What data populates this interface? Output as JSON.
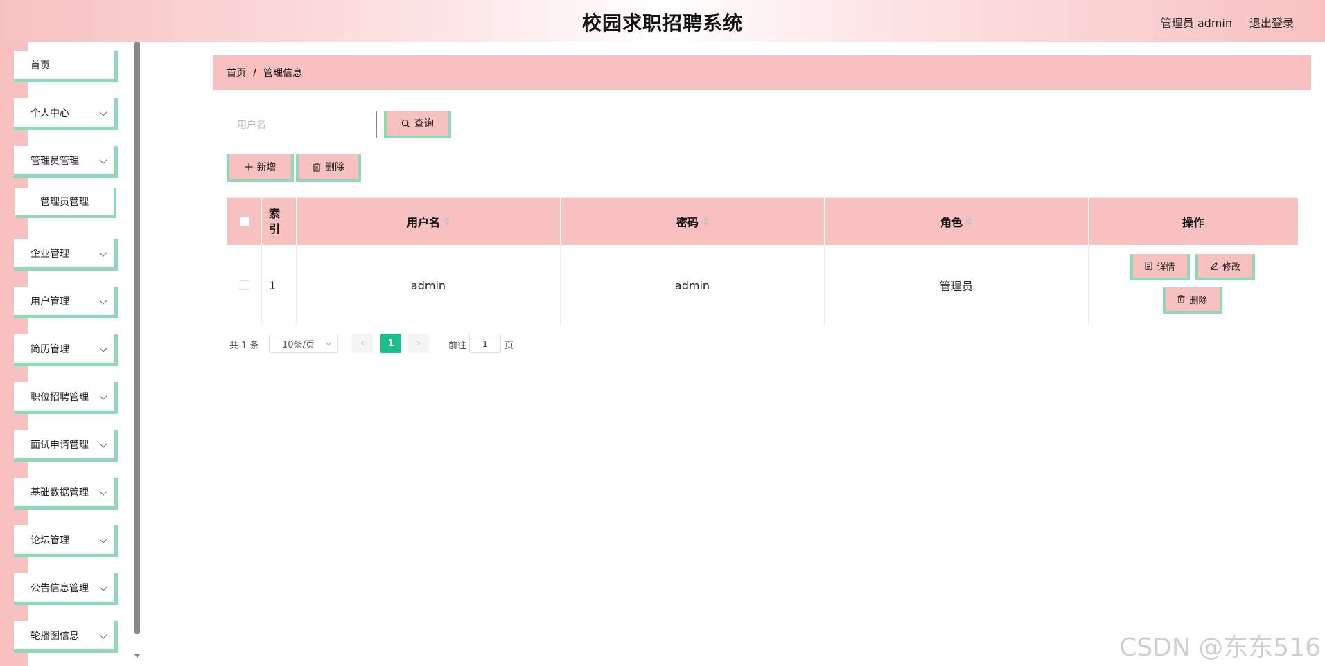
{
  "header": {
    "title": "校园求职招聘系统",
    "user_label": "管理员 admin",
    "logout_label": "退出登录"
  },
  "sidebar": {
    "items": [
      {
        "label": "首页",
        "has_children": false
      },
      {
        "label": "个人中心",
        "has_children": true
      },
      {
        "label": "管理员管理",
        "has_children": true
      },
      {
        "label": "企业管理",
        "has_children": true
      },
      {
        "label": "用户管理",
        "has_children": true
      },
      {
        "label": "简历管理",
        "has_children": true
      },
      {
        "label": "职位招聘管理",
        "has_children": true
      },
      {
        "label": "面试申请管理",
        "has_children": true
      },
      {
        "label": "基础数据管理",
        "has_children": true
      },
      {
        "label": "论坛管理",
        "has_children": true
      },
      {
        "label": "公告信息管理",
        "has_children": true
      },
      {
        "label": "轮播图信息",
        "has_children": true
      }
    ],
    "sub_items": [
      {
        "label": "管理员管理"
      }
    ]
  },
  "breadcrumb": {
    "home": "首页",
    "separator": "/",
    "current": "管理信息"
  },
  "search": {
    "placeholder": "用户名",
    "value": "",
    "button_label": "查询",
    "button_icon": "search-icon"
  },
  "toolbar": {
    "add_label": "新增",
    "add_icon": "plus-icon",
    "delete_label": "删除",
    "delete_icon": "trash-icon"
  },
  "table": {
    "columns": [
      "索引",
      "用户名",
      "密码",
      "角色",
      "操作"
    ],
    "rows": [
      {
        "index": "1",
        "username": "admin",
        "password": "admin",
        "role": "管理员"
      }
    ],
    "actions": {
      "detail_label": "详情",
      "detail_icon": "document-icon",
      "edit_label": "修改",
      "edit_icon": "edit-icon",
      "delete_label": "删除",
      "delete_icon": "trash-icon"
    }
  },
  "pagination": {
    "total_text": "共 1 条",
    "page_size": "10条/页",
    "current_page": "1",
    "goto_label": "前往",
    "goto_value": "1",
    "page_suffix": "页"
  },
  "watermark": "CSDN @东东516",
  "colors": {
    "accent_pink": "#f7c1c1",
    "accent_green": "#8fd9b6",
    "page_active": "#19be8b"
  }
}
